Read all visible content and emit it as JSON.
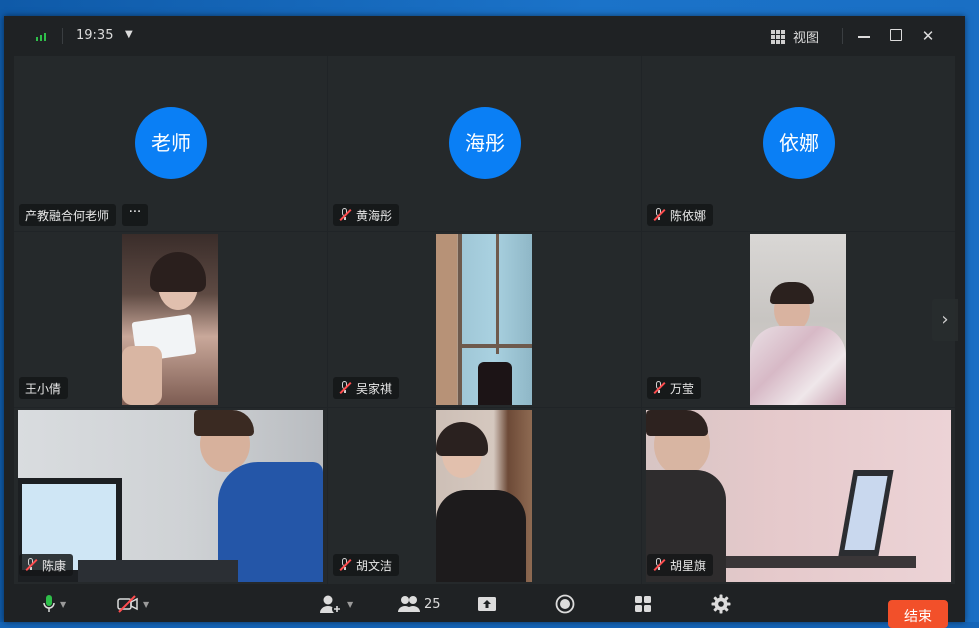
{
  "titlebar": {
    "time": "19:35",
    "view_label": "视图"
  },
  "participants_row1": [
    {
      "avatar_text": "老师",
      "name": "产教融合何老师",
      "muted": false
    },
    {
      "avatar_text": "海彤",
      "name": "黄海彤",
      "muted": true
    },
    {
      "avatar_text": "依娜",
      "name": "陈依娜",
      "muted": true
    }
  ],
  "participants_row2": [
    {
      "name": "王小倩",
      "muted": false
    },
    {
      "name": "吴家祺",
      "muted": true
    },
    {
      "name": "万莹",
      "muted": true
    }
  ],
  "participants_row3": [
    {
      "name": "陈康",
      "muted": true
    },
    {
      "name": "胡文洁",
      "muted": true
    },
    {
      "name": "胡星旗",
      "muted": true
    }
  ],
  "toolbar": {
    "participant_count": "25",
    "end_label": "结束"
  },
  "colors": {
    "avatar_blue": "#0a7ff5",
    "end_button": "#f2502a",
    "mute_red": "#ff4d4f",
    "signal_green": "#2fbf4a"
  }
}
